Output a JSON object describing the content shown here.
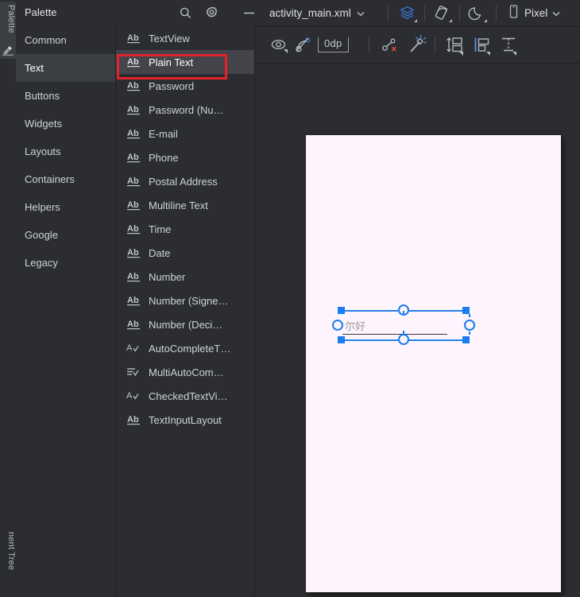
{
  "colors": {
    "panel_bg": "#2b2d30",
    "selected_row": "#43454a",
    "selected_cat": "#3c3f41",
    "annotation_red": "#e5222a",
    "accent_blue": "#1a7ef0",
    "device_bg": "#fdf4fd",
    "text_primary": "#dfe1e5",
    "text_secondary": "#cfd2d6"
  },
  "tool_strip": {
    "tabs": [
      {
        "label": "Palette",
        "active": true,
        "icon": "palette-icon"
      },
      {
        "label": "nent Tree",
        "active": false,
        "icon": "component-tree-icon"
      }
    ]
  },
  "palette": {
    "title": "Palette",
    "header_buttons": [
      {
        "name": "search-icon",
        "label": "Search"
      },
      {
        "name": "gear-icon",
        "label": "Palette Settings"
      },
      {
        "name": "minimize-icon",
        "label": "Hide"
      }
    ],
    "categories": [
      {
        "label": "Common",
        "selected": false
      },
      {
        "label": "Text",
        "selected": true
      },
      {
        "label": "Buttons",
        "selected": false
      },
      {
        "label": "Widgets",
        "selected": false
      },
      {
        "label": "Layouts",
        "selected": false
      },
      {
        "label": "Containers",
        "selected": false
      },
      {
        "label": "Helpers",
        "selected": false
      },
      {
        "label": "Google",
        "selected": false
      },
      {
        "label": "Legacy",
        "selected": false
      }
    ],
    "widgets": [
      {
        "label": "TextView",
        "icon": "ab-icon",
        "selected": false
      },
      {
        "label": "Plain Text",
        "icon": "ab-icon",
        "selected": true
      },
      {
        "label": "Password",
        "icon": "ab-icon",
        "selected": false
      },
      {
        "label": "Password (Nu…",
        "icon": "ab-icon",
        "selected": false
      },
      {
        "label": "E-mail",
        "icon": "ab-icon",
        "selected": false
      },
      {
        "label": "Phone",
        "icon": "ab-icon",
        "selected": false
      },
      {
        "label": "Postal Address",
        "icon": "ab-icon",
        "selected": false
      },
      {
        "label": "Multiline Text",
        "icon": "ab-icon",
        "selected": false
      },
      {
        "label": "Time",
        "icon": "ab-icon",
        "selected": false
      },
      {
        "label": "Date",
        "icon": "ab-icon",
        "selected": false
      },
      {
        "label": "Number",
        "icon": "ab-icon",
        "selected": false
      },
      {
        "label": "Number (Signe…",
        "icon": "ab-icon",
        "selected": false
      },
      {
        "label": "Number (Deci…",
        "icon": "ab-icon",
        "selected": false
      },
      {
        "label": "AutoCompleteT…",
        "icon": "a-check-icon",
        "selected": false
      },
      {
        "label": "MultiAutoCom…",
        "icon": "lines-check-icon",
        "selected": false
      },
      {
        "label": "CheckedTextVi…",
        "icon": "a-check-icon",
        "selected": false
      },
      {
        "label": "TextInputLayout",
        "icon": "ab-icon",
        "selected": false
      }
    ]
  },
  "editor": {
    "file_tab": {
      "label": "activity_main.xml",
      "chevron": "chevron-down-icon"
    },
    "top_buttons": [
      {
        "name": "layers-icon",
        "label": "Design Surface Layers"
      },
      {
        "name": "orientation-icon",
        "label": "Orientation for Preview"
      },
      {
        "name": "night-mode-icon",
        "label": "UI Mode for Preview"
      }
    ],
    "device_selector": {
      "label": "Pixel",
      "icon": "device-icon",
      "chevron": "chevron-down-icon"
    }
  },
  "design_toolbar": {
    "buttons": [
      {
        "name": "view-options-icon",
        "label": "View Options"
      },
      {
        "name": "toggle-constraints-icon",
        "label": "Toggle Visibility of Constraints"
      },
      {
        "name": "default-margin-value",
        "label": "0dp"
      },
      {
        "name": "clear-constraints-icon",
        "label": "Clear All Constraints"
      },
      {
        "name": "infer-constraints-icon",
        "label": "Infer Constraints"
      },
      {
        "name": "pack-icon",
        "label": "Pack"
      },
      {
        "name": "align-icon",
        "label": "Align"
      },
      {
        "name": "guidelines-icon",
        "label": "Guidelines"
      }
    ]
  },
  "canvas": {
    "selected_component": {
      "hint_text": "尔好",
      "type": "EditText"
    }
  }
}
